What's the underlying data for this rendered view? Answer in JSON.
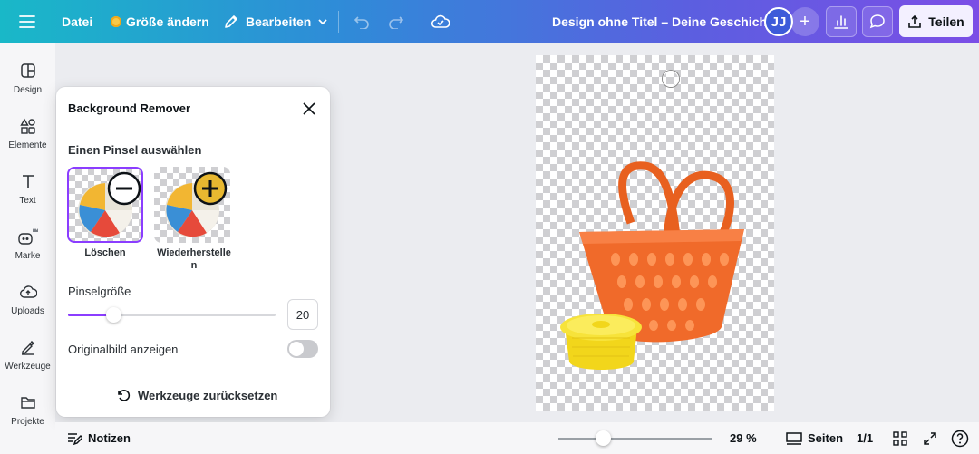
{
  "topbar": {
    "menu_icon": "hamburger-icon",
    "file_label": "Datei",
    "resize_label": "Größe ändern",
    "edit_label": "Bearbeiten",
    "doc_title": "Design ohne Titel – Deine Geschichte",
    "avatar_initials": "JJ",
    "share_label": "Teilen"
  },
  "sidebar": {
    "items": [
      {
        "label": "Design",
        "icon": "layout-icon"
      },
      {
        "label": "Elemente",
        "icon": "shapes-icon"
      },
      {
        "label": "Text",
        "icon": "text-icon"
      },
      {
        "label": "Marke",
        "icon": "brand-icon"
      },
      {
        "label": "Uploads",
        "icon": "upload-icon"
      },
      {
        "label": "Werkzeuge",
        "icon": "tools-icon"
      },
      {
        "label": "Projekte",
        "icon": "folder-icon"
      }
    ]
  },
  "panel": {
    "title": "Background Remover",
    "brush_heading": "Einen Pinsel auswählen",
    "brush_erase_label": "Löschen",
    "brush_restore_label": "Wiederherstellen",
    "brush_size_label": "Pinselgröße",
    "brush_size_value": "20",
    "brush_size_fraction": 0.22,
    "show_original_label": "Originalbild anzeigen",
    "show_original": false,
    "reset_label": "Werkzeuge zurücksetzen"
  },
  "bottombar": {
    "notes_label": "Notizen",
    "zoom_label": "29 %",
    "zoom_fraction": 0.29,
    "pages_label": "Seiten",
    "page_count": "1/1"
  },
  "colors": {
    "accent": "#8b3dff",
    "basket": "#f06a2a",
    "container": "#f5dc1f"
  }
}
